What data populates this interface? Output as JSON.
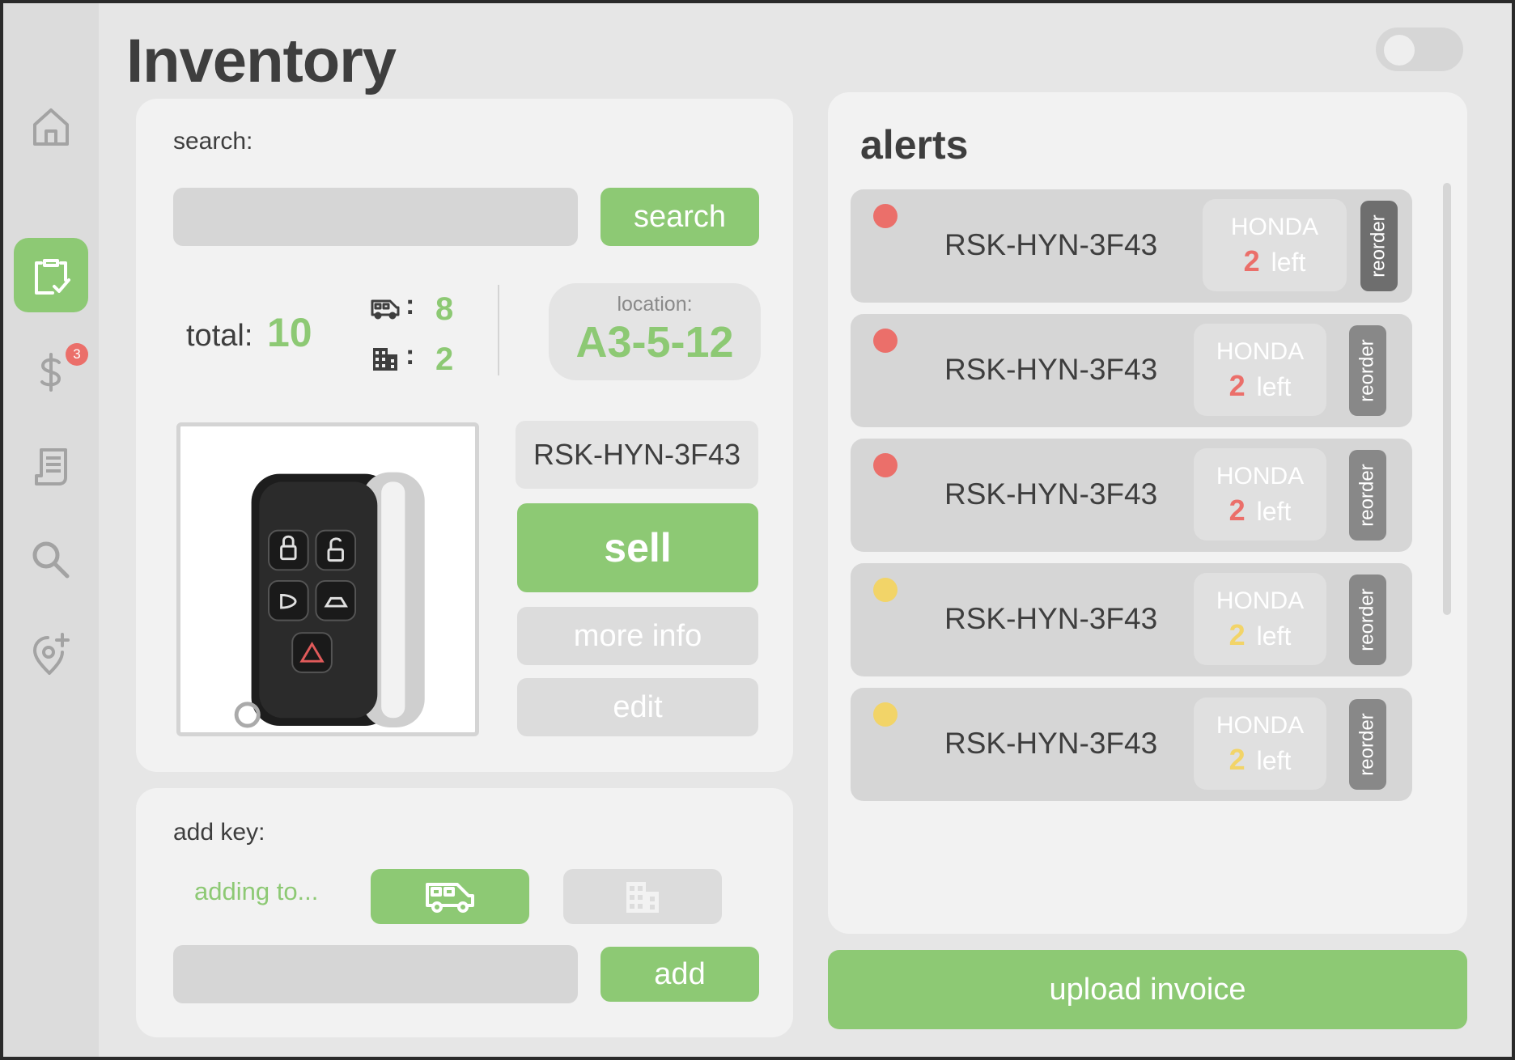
{
  "page": {
    "title": "Inventory"
  },
  "sidebar": {
    "items": [
      {
        "name": "home",
        "icon": "home-icon"
      },
      {
        "name": "inventory",
        "icon": "clipboard-check-icon",
        "active": true
      },
      {
        "name": "sales",
        "icon": "dollar-icon",
        "badge": "3"
      },
      {
        "name": "receipts",
        "icon": "receipt-icon"
      },
      {
        "name": "search",
        "icon": "search-icon"
      },
      {
        "name": "add-location",
        "icon": "location-plus-icon"
      }
    ]
  },
  "search": {
    "label": "search:",
    "input_value": "",
    "button_label": "search"
  },
  "stats": {
    "total_label": "total:",
    "total_value": "10",
    "van_count": "8",
    "building_count": "2",
    "colon": ":"
  },
  "location": {
    "label": "location:",
    "value": "A3-5-12"
  },
  "item": {
    "sku": "RSK-HYN-3F43",
    "sell_label": "sell",
    "more_info_label": "more info",
    "edit_label": "edit",
    "image_icon": "car-key-fob-icon"
  },
  "add_key": {
    "label": "add key:",
    "adding_to_label": "adding to...",
    "van_icon": "van-icon",
    "building_icon": "building-icon",
    "input_value": "",
    "add_label": "add"
  },
  "alerts": {
    "title": "alerts",
    "reorder_label": "reorder",
    "left_label": "left",
    "items": [
      {
        "sku": "RSK-HYN-3F43",
        "brand": "HONDA",
        "count": "2",
        "status_color": "#eb6f6a"
      },
      {
        "sku": "RSK-HYN-3F43",
        "brand": "HONDA",
        "count": "2",
        "status_color": "#eb6f6a"
      },
      {
        "sku": "RSK-HYN-3F43",
        "brand": "HONDA",
        "count": "2",
        "status_color": "#eb6f6a"
      },
      {
        "sku": "RSK-HYN-3F43",
        "brand": "HONDA",
        "count": "2",
        "status_color": "#f2d468"
      },
      {
        "sku": "RSK-HYN-3F43",
        "brand": "HONDA",
        "count": "2",
        "status_color": "#f2d468"
      }
    ]
  },
  "upload_invoice_label": "upload invoice",
  "colors": {
    "accent": "#8dc974",
    "alert_red": "#eb6f6a",
    "alert_yellow": "#f2d468",
    "text_dark": "#3e3e3e"
  }
}
